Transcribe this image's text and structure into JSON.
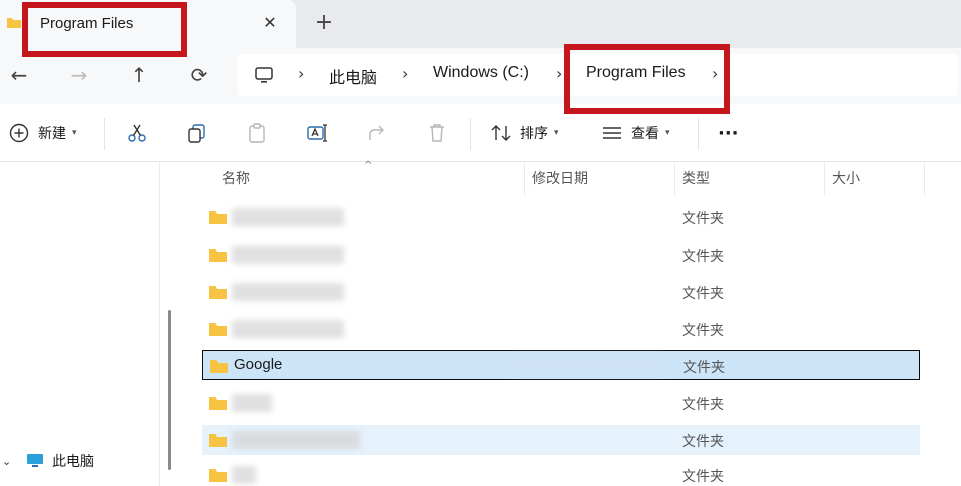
{
  "window": {
    "tab_title": "Program Files",
    "tab_close": "✕",
    "new_tab": "+"
  },
  "nav": {
    "back": "←",
    "forward": "→",
    "up": "↑",
    "refresh": "⟳"
  },
  "breadcrumb": {
    "items": [
      "此电脑",
      "Windows (C:)",
      "Program Files"
    ],
    "separator": "›"
  },
  "toolbar": {
    "new_label": "新建",
    "sort_label": "排序",
    "view_label": "查看",
    "more_label": "···"
  },
  "sidebar": {
    "this_pc_label": "此电脑"
  },
  "columns": {
    "name": "名称",
    "modified": "修改日期",
    "type": "类型",
    "size": "大小"
  },
  "rows": [
    {
      "name": "",
      "type": "文件夹",
      "state": "normal"
    },
    {
      "name": "",
      "type": "文件夹",
      "state": "normal"
    },
    {
      "name": "",
      "type": "文件夹",
      "state": "normal"
    },
    {
      "name": "",
      "type": "文件夹",
      "state": "normal"
    },
    {
      "name": "Google",
      "type": "文件夹",
      "state": "selected"
    },
    {
      "name": "",
      "type": "文件夹",
      "state": "normal"
    },
    {
      "name": "",
      "type": "文件夹",
      "state": "hover"
    },
    {
      "name": "",
      "type": "文件夹",
      "state": "normal"
    }
  ],
  "colors": {
    "accent_red": "#c5161d",
    "selection": "#cce4f7",
    "folder": "#f6c343"
  },
  "icons": {
    "folder": "folder-icon",
    "pc": "computer-icon",
    "cut": "scissors-icon",
    "copy": "copy-icon",
    "paste": "clipboard-icon",
    "rename": "rename-icon",
    "share": "share-icon",
    "delete": "trash-icon"
  }
}
